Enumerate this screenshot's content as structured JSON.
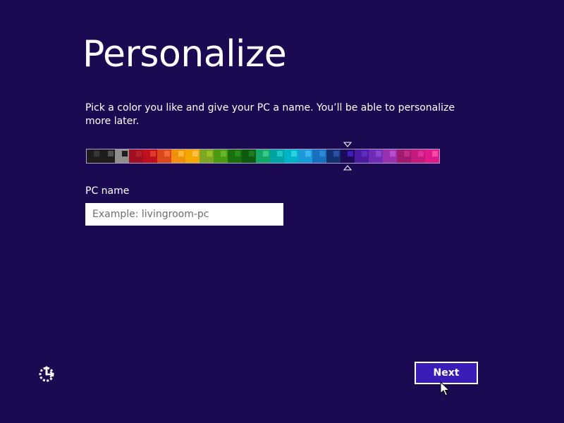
{
  "title": "Personalize",
  "description": "Pick a color you like and give your PC a name. You’ll be able to personalize more later.",
  "color_picker": {
    "selected_index": 17,
    "swatches": [
      {
        "bg": "#1d1d1d",
        "accent": "#383838"
      },
      {
        "bg": "#1d1d1d",
        "accent": "#505050"
      },
      {
        "bg": "#8e8e8e",
        "accent": "#1d1d1d"
      },
      {
        "bg": "#a01020",
        "accent": "#b81e2a"
      },
      {
        "bg": "#c0101f",
        "accent": "#e03a2c"
      },
      {
        "bg": "#d8481a",
        "accent": "#f26a3a"
      },
      {
        "bg": "#f0900c",
        "accent": "#f8b830"
      },
      {
        "bg": "#f2a800",
        "accent": "#fcc24a"
      },
      {
        "bg": "#7ea622",
        "accent": "#98c028"
      },
      {
        "bg": "#4a9a12",
        "accent": "#66b82a"
      },
      {
        "bg": "#1a6e0e",
        "accent": "#2a8a1a"
      },
      {
        "bg": "#0e5a0e",
        "accent": "#1f7a26"
      },
      {
        "bg": "#12a86a",
        "accent": "#3ac88a"
      },
      {
        "bg": "#00a3a3",
        "accent": "#20c4c4"
      },
      {
        "bg": "#00b4c8",
        "accent": "#30d0e0"
      },
      {
        "bg": "#1a9ad8",
        "accent": "#40b4ee"
      },
      {
        "bg": "#1a6ec0",
        "accent": "#2a8ad8"
      },
      {
        "bg": "#15306e",
        "accent": "#2b4ea8"
      },
      {
        "bg": "#1d0a58",
        "accent": "#3a1cb8"
      },
      {
        "bg": "#4a1aa0",
        "accent": "#5e2cc0"
      },
      {
        "bg": "#6e2ab4",
        "accent": "#8a44d0"
      },
      {
        "bg": "#9a30b0",
        "accent": "#b650cc"
      },
      {
        "bg": "#a01a70",
        "accent": "#c02e8a"
      },
      {
        "bg": "#c41a7e",
        "accent": "#e02e98"
      },
      {
        "bg": "#e01a8a",
        "accent": "#f848a8"
      }
    ]
  },
  "pc_name": {
    "label": "PC name",
    "placeholder": "Example: livingroom-pc",
    "value": ""
  },
  "buttons": {
    "next_label": "Next"
  },
  "icons": {
    "ease_of_access": "ease-of-access-icon",
    "selection_marker": "triangle-marker-icon",
    "mouse_pointer": "arrow-cursor-icon"
  },
  "colors": {
    "background": "#1b0a52",
    "accent": "#3a1cb8",
    "text": "#ffffff"
  }
}
